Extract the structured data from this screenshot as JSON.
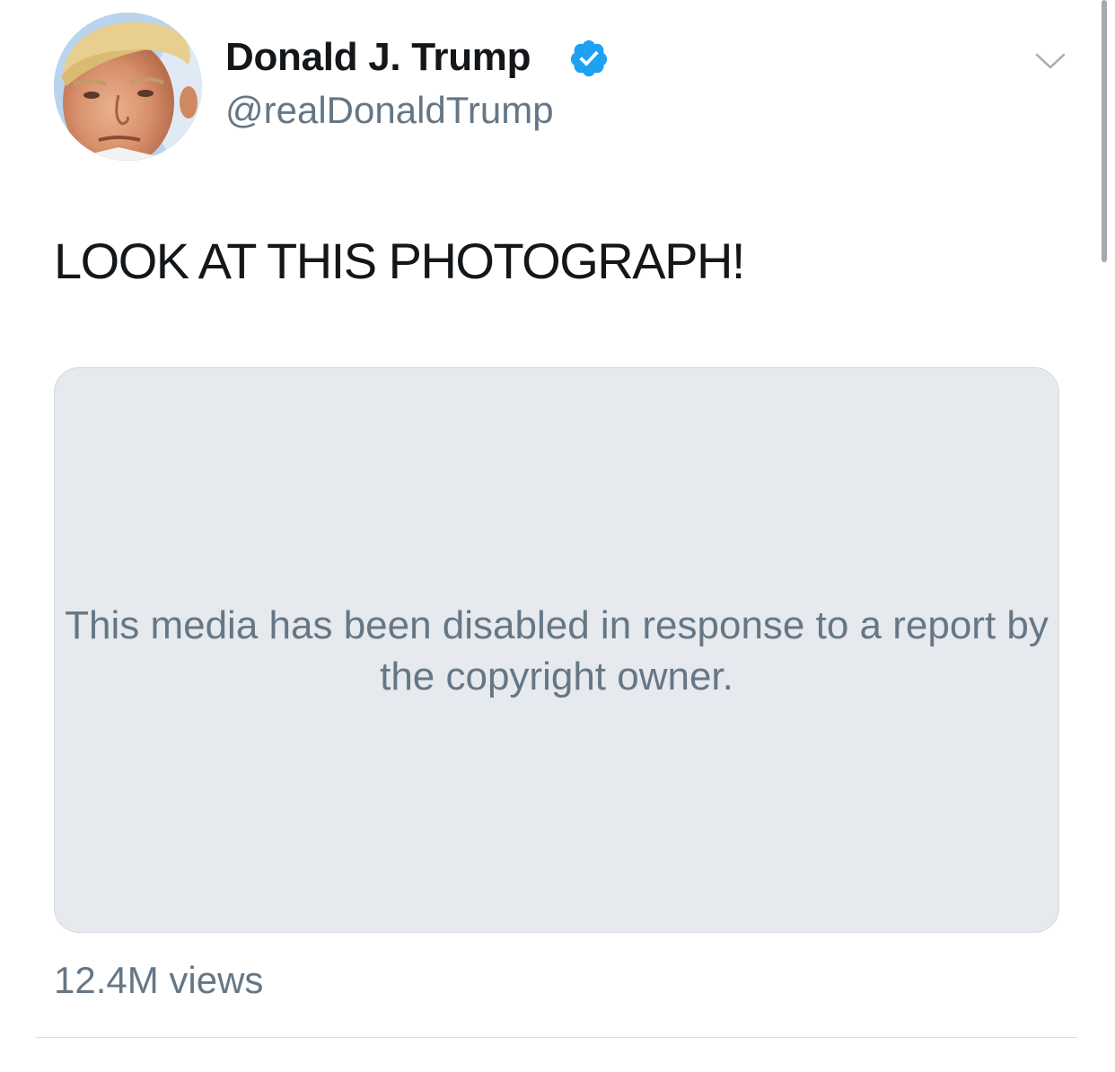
{
  "tweet": {
    "display_name": "Donald J. Trump",
    "handle": "@realDonaldTrump",
    "verified": true,
    "text": "LOOK AT THIS PHOTOGRAPH!",
    "media_message": "This media has been disabled in response to a report by the copyright owner.",
    "views": "12.4M views"
  },
  "icons": {
    "verified": "verified-badge-icon",
    "menu": "chevron-down-icon",
    "avatar": "profile-photo"
  },
  "colors": {
    "verified_blue": "#1da1f2",
    "secondary_text": "#657786",
    "media_background": "#e6e9ed",
    "primary_text": "#14171a"
  }
}
